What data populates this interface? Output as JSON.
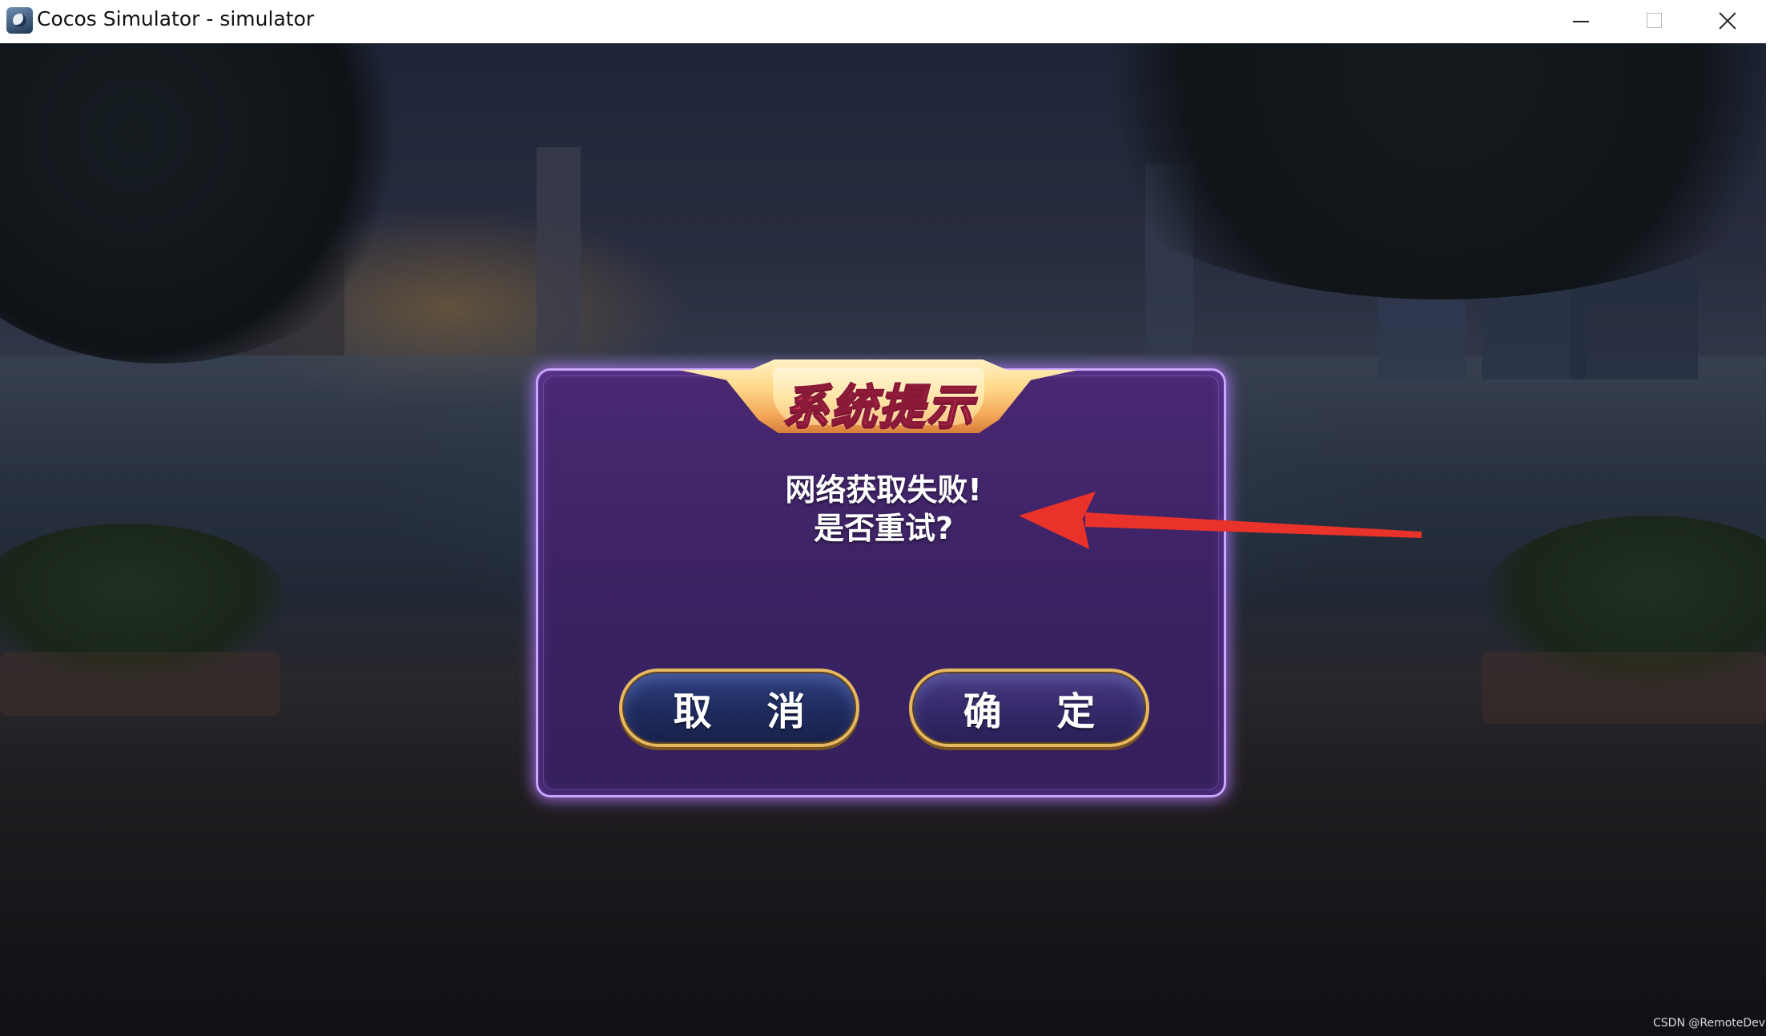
{
  "window": {
    "title": "Cocos Simulator - simulator"
  },
  "dialog": {
    "title": "系统提示",
    "message_line1": "网络获取失败!",
    "message_line2": "是否重试?",
    "cancel_label": "取 消",
    "confirm_label": "确 定"
  },
  "annotation": {
    "arrow_color": "#e8322a"
  },
  "watermark": "CSDN @RemoteDev",
  "colors": {
    "dialog_bg": "#3d2365",
    "dialog_border": "#c9a6ff",
    "button_border": "#e6b860",
    "title_text": "#e23a5c"
  }
}
